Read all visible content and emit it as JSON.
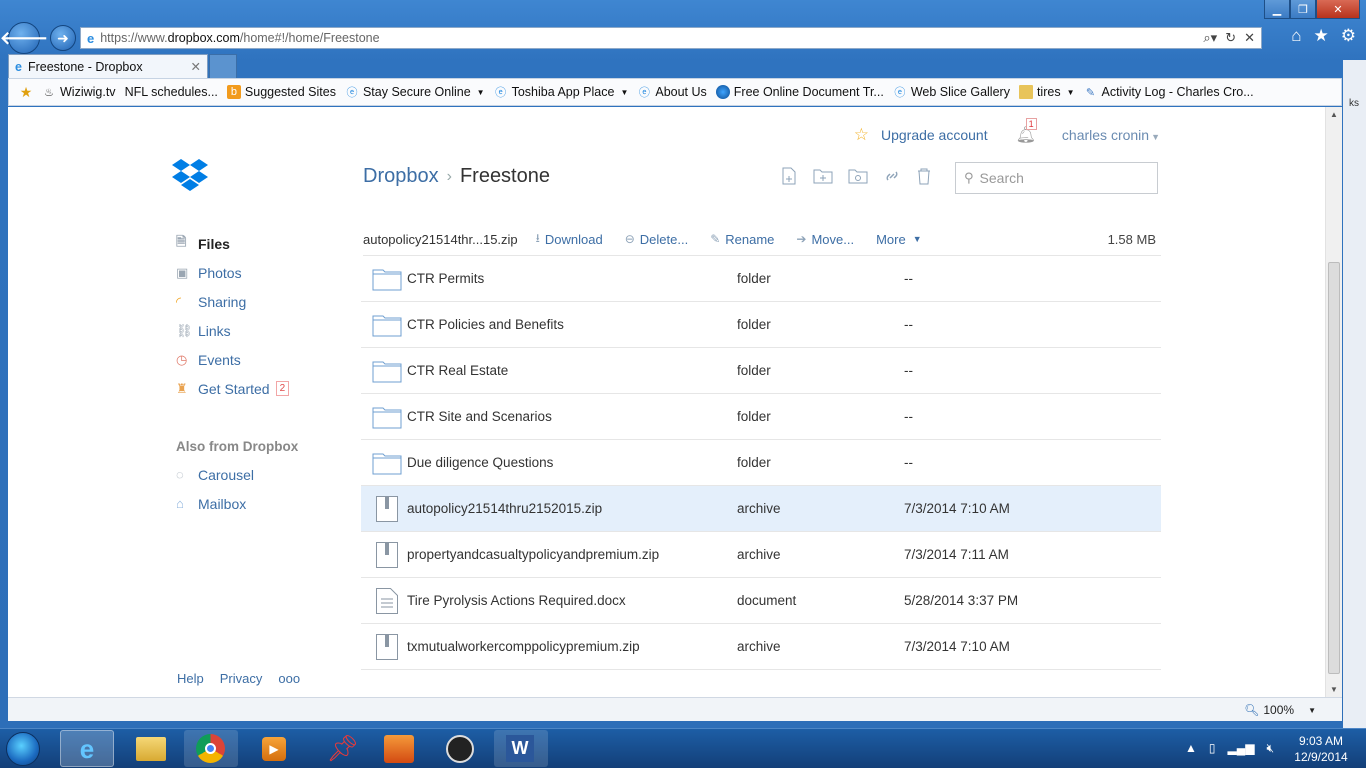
{
  "browser": {
    "url_prefix": "https://www.",
    "url_domain": "dropbox.com",
    "url_path": "/home#!/home/Freestone",
    "tab_title": "Freestone - Dropbox",
    "favorites": [
      {
        "label": "Wiziwig.tv",
        "icon": "flame-icon",
        "caret": false
      },
      {
        "label": "NFL schedules...",
        "icon": "",
        "caret": false
      },
      {
        "label": "Suggested Sites",
        "icon": "suggested-sites-icon",
        "caret": false
      },
      {
        "label": "Stay Secure Online",
        "icon": "ie-page-icon",
        "caret": true
      },
      {
        "label": "Toshiba App Place",
        "icon": "ie-page-icon",
        "caret": true
      },
      {
        "label": "About Us",
        "icon": "ie-page-icon",
        "caret": false
      },
      {
        "label": "Free Online Document Tr...",
        "icon": "globe-icon",
        "caret": false
      },
      {
        "label": "Web Slice Gallery",
        "icon": "ie-page-icon",
        "caret": false
      },
      {
        "label": "tires",
        "icon": "folder-icon",
        "caret": true
      },
      {
        "label": "Activity Log - Charles Cro...",
        "icon": "activity-icon",
        "caret": false
      }
    ],
    "zoom": "100%",
    "side_text": "ks"
  },
  "header": {
    "upgrade_label": "Upgrade account",
    "notification_count": "1",
    "user_name": "charles cronin"
  },
  "sidebar": {
    "items": [
      {
        "label": "Files",
        "icon": "files-icon",
        "active": true
      },
      {
        "label": "Photos",
        "icon": "photos-icon",
        "active": false
      },
      {
        "label": "Sharing",
        "icon": "sharing-icon",
        "active": false
      },
      {
        "label": "Links",
        "icon": "links-icon",
        "active": false
      },
      {
        "label": "Events",
        "icon": "events-icon",
        "active": false
      },
      {
        "label": "Get Started",
        "icon": "get-started-icon",
        "active": false,
        "badge": "2"
      }
    ],
    "also_heading": "Also from Dropbox",
    "also_items": [
      {
        "label": "Carousel",
        "icon": "carousel-icon"
      },
      {
        "label": "Mailbox",
        "icon": "mailbox-icon"
      }
    ],
    "footer_links": [
      "Help",
      "Privacy",
      "ooo"
    ]
  },
  "breadcrumb": {
    "root": "Dropbox",
    "separator": "›",
    "current": "Freestone"
  },
  "search": {
    "placeholder": "Search"
  },
  "actionbar": {
    "selected_name": "autopolicy21514thr...15.zip",
    "download": "Download",
    "delete": "Delete...",
    "rename": "Rename",
    "move": "Move...",
    "more": "More",
    "size": "1.58 MB"
  },
  "files": [
    {
      "name": "CTR Permits",
      "kind": "folder",
      "modified": "--",
      "type": "folder",
      "selected": false
    },
    {
      "name": "CTR Policies and Benefits",
      "kind": "folder",
      "modified": "--",
      "type": "folder",
      "selected": false
    },
    {
      "name": "CTR Real Estate",
      "kind": "folder",
      "modified": "--",
      "type": "folder",
      "selected": false
    },
    {
      "name": "CTR Site and Scenarios",
      "kind": "folder",
      "modified": "--",
      "type": "folder",
      "selected": false
    },
    {
      "name": "Due diligence Questions",
      "kind": "folder",
      "modified": "--",
      "type": "folder",
      "selected": false
    },
    {
      "name": "autopolicy21514thru2152015.zip",
      "kind": "archive",
      "modified": "7/3/2014 7:10 AM",
      "type": "archive",
      "selected": true
    },
    {
      "name": "propertyandcasualtypolicyandpremium.zip",
      "kind": "archive",
      "modified": "7/3/2014 7:11 AM",
      "type": "archive",
      "selected": false
    },
    {
      "name": "Tire Pyrolysis Actions Required.docx",
      "kind": "document",
      "modified": "5/28/2014 3:37 PM",
      "type": "document",
      "selected": false
    },
    {
      "name": "txmutualworkercomppolicypremium.zip",
      "kind": "archive",
      "modified": "7/3/2014 7:10 AM",
      "type": "archive",
      "selected": false
    }
  ],
  "taskbar": {
    "time": "9:03 AM",
    "date": "12/9/2014",
    "apps": [
      "start-orb-icon",
      "ie-icon",
      "file-explorer-icon",
      "chrome-icon",
      "media-player-icon",
      "pin-icon",
      "app-icon",
      "clock-app-icon",
      "word-icon"
    ]
  },
  "colors": {
    "link": "#3d6ea5",
    "selected_row": "#e4effb",
    "dropbox_blue": "#007ee5"
  }
}
